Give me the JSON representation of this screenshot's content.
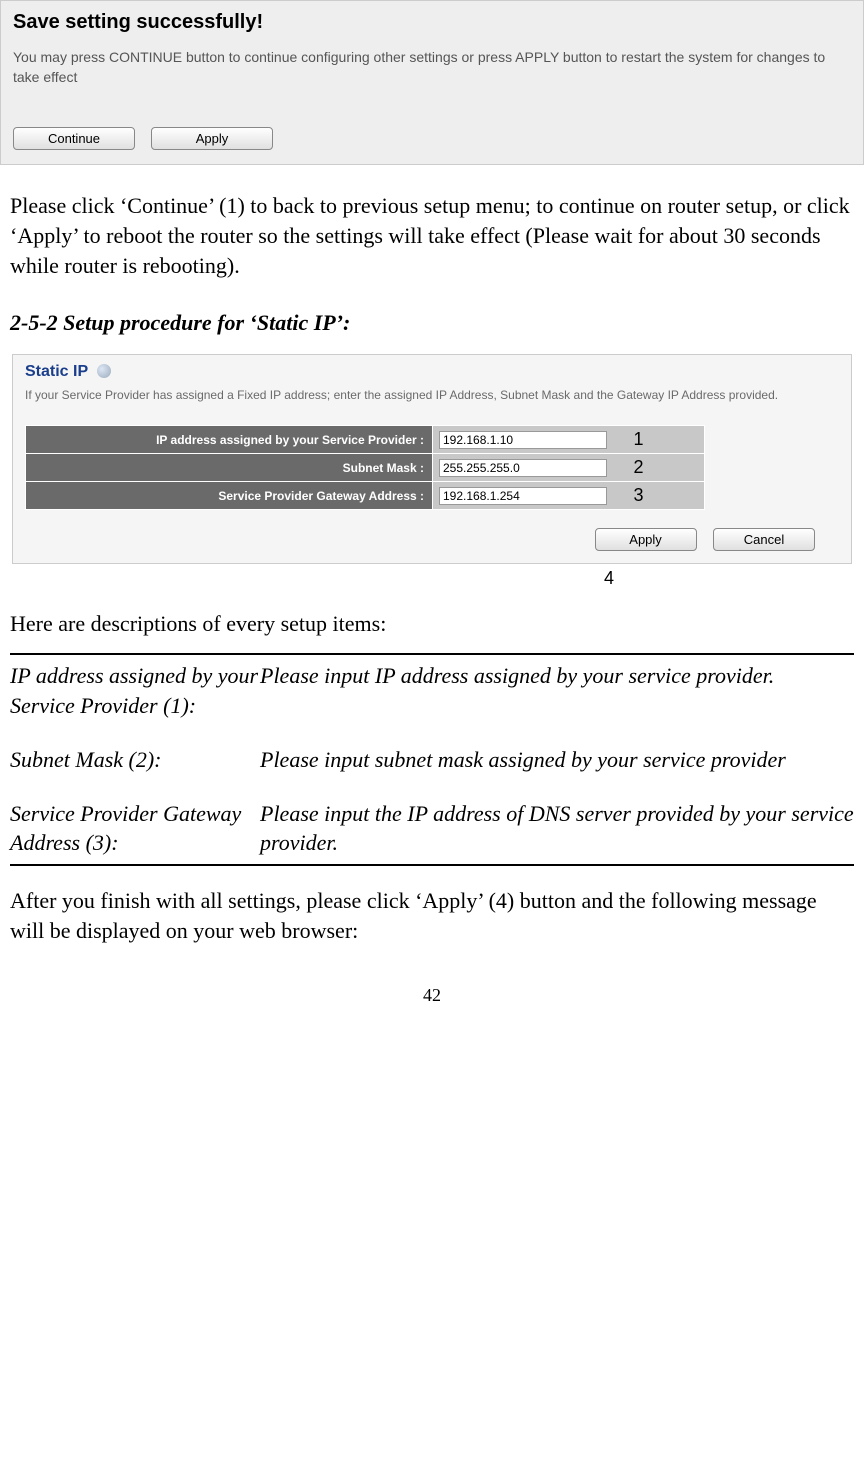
{
  "screenshot1": {
    "title": "Save setting successfully!",
    "subtext": "You may press CONTINUE button to continue configuring other settings or press APPLY button to restart the system for changes to take effect",
    "continue_label": "Continue",
    "apply_label": "Apply"
  },
  "para1": "Please click ‘Continue’ (1) to back to previous setup menu; to continue on router setup, or click ‘Apply’ to reboot the router so the settings will take effect (Please wait for about 30 seconds while router is rebooting).",
  "section_heading": "2-5-2 Setup procedure for ‘Static IP’:",
  "screenshot2": {
    "title": "Static IP",
    "desc": "If your Service Provider has assigned a Fixed IP address; enter the assigned IP Address, Subnet Mask and the Gateway IP Address provided.",
    "rows": [
      {
        "label": "IP address assigned by your Service Provider :",
        "value": "192.168.1.10",
        "annot": "1"
      },
      {
        "label": "Subnet Mask :",
        "value": "255.255.255.0",
        "annot": "2"
      },
      {
        "label": "Service Provider Gateway Address :",
        "value": "192.168.1.254",
        "annot": "3"
      }
    ],
    "apply_label": "Apply",
    "cancel_label": "Cancel",
    "annot4": "4"
  },
  "desc_intro": "Here are descriptions of every setup items:",
  "desc_table": [
    {
      "left": "IP address assigned by your Service Provider (1):",
      "right": "Please input IP address assigned by your service provider."
    },
    {
      "left": "Subnet Mask (2):",
      "right": "Please input subnet mask assigned by your service provider"
    },
    {
      "left": "Service Provider Gateway Address (3):",
      "right": "Please input the IP address of DNS server provided by your service provider."
    }
  ],
  "para2": "After you finish with all settings, please click ‘Apply’ (4) button and the following message will be displayed on your web browser:",
  "page_number": "42"
}
